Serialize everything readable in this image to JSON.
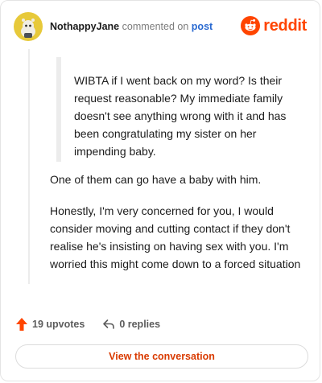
{
  "header": {
    "username": "NothappyJane",
    "action_text": "commented on",
    "post_link": "post",
    "brand": "reddit"
  },
  "quote": "WIBTA if I went back on my word? Is their request reasonable? My immediate family doesn't see anything wrong with it and has been congratulating my sister on her impending baby.",
  "paragraphs": [
    "One of them can go have a baby with him.",
    "Honestly, I'm very concerned for you, I would consider moving and cutting contact if they don't realise he's insisting on having sex with you. I'm worried this might come down to a forced situation"
  ],
  "actions": {
    "upvotes": "19 upvotes",
    "replies": "0 replies"
  },
  "cta": "View the conversation",
  "icons": {
    "avatar": "snoo-avatar-icon",
    "brand": "reddit-logo-icon",
    "upvote": "upvote-arrow-icon",
    "reply": "reply-arrow-icon"
  },
  "colors": {
    "brand": "#ff4500",
    "link": "#2a6ad1",
    "cta": "#d93a00",
    "upvote": "#ff4500"
  }
}
